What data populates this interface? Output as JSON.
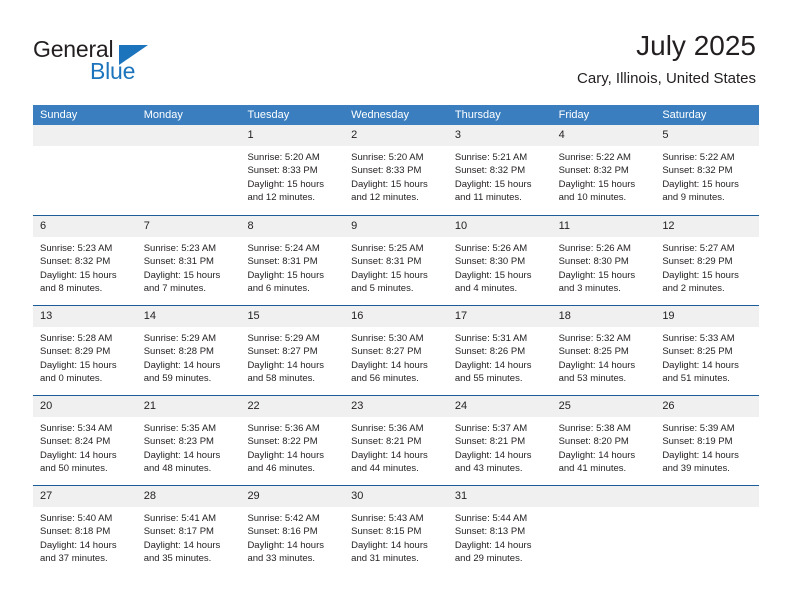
{
  "brand": {
    "name_part1": "General",
    "name_part2": "Blue",
    "accent_color": "#1c75bc"
  },
  "header": {
    "title": "July 2025",
    "subtitle": "Cary, Illinois, United States"
  },
  "theme": {
    "header_bar_color": "#3a7ebf",
    "row_divider_color": "#1c5d99",
    "day_number_bg": "#f0f0f0",
    "text_color": "#231f20"
  },
  "weekdays": [
    "Sunday",
    "Monday",
    "Tuesday",
    "Wednesday",
    "Thursday",
    "Friday",
    "Saturday"
  ],
  "weeks": [
    [
      {
        "day": "",
        "lines": []
      },
      {
        "day": "",
        "lines": []
      },
      {
        "day": "1",
        "lines": [
          "Sunrise: 5:20 AM",
          "Sunset: 8:33 PM",
          "Daylight: 15 hours",
          "and 12 minutes."
        ]
      },
      {
        "day": "2",
        "lines": [
          "Sunrise: 5:20 AM",
          "Sunset: 8:33 PM",
          "Daylight: 15 hours",
          "and 12 minutes."
        ]
      },
      {
        "day": "3",
        "lines": [
          "Sunrise: 5:21 AM",
          "Sunset: 8:32 PM",
          "Daylight: 15 hours",
          "and 11 minutes."
        ]
      },
      {
        "day": "4",
        "lines": [
          "Sunrise: 5:22 AM",
          "Sunset: 8:32 PM",
          "Daylight: 15 hours",
          "and 10 minutes."
        ]
      },
      {
        "day": "5",
        "lines": [
          "Sunrise: 5:22 AM",
          "Sunset: 8:32 PM",
          "Daylight: 15 hours",
          "and 9 minutes."
        ]
      }
    ],
    [
      {
        "day": "6",
        "lines": [
          "Sunrise: 5:23 AM",
          "Sunset: 8:32 PM",
          "Daylight: 15 hours",
          "and 8 minutes."
        ]
      },
      {
        "day": "7",
        "lines": [
          "Sunrise: 5:23 AM",
          "Sunset: 8:31 PM",
          "Daylight: 15 hours",
          "and 7 minutes."
        ]
      },
      {
        "day": "8",
        "lines": [
          "Sunrise: 5:24 AM",
          "Sunset: 8:31 PM",
          "Daylight: 15 hours",
          "and 6 minutes."
        ]
      },
      {
        "day": "9",
        "lines": [
          "Sunrise: 5:25 AM",
          "Sunset: 8:31 PM",
          "Daylight: 15 hours",
          "and 5 minutes."
        ]
      },
      {
        "day": "10",
        "lines": [
          "Sunrise: 5:26 AM",
          "Sunset: 8:30 PM",
          "Daylight: 15 hours",
          "and 4 minutes."
        ]
      },
      {
        "day": "11",
        "lines": [
          "Sunrise: 5:26 AM",
          "Sunset: 8:30 PM",
          "Daylight: 15 hours",
          "and 3 minutes."
        ]
      },
      {
        "day": "12",
        "lines": [
          "Sunrise: 5:27 AM",
          "Sunset: 8:29 PM",
          "Daylight: 15 hours",
          "and 2 minutes."
        ]
      }
    ],
    [
      {
        "day": "13",
        "lines": [
          "Sunrise: 5:28 AM",
          "Sunset: 8:29 PM",
          "Daylight: 15 hours",
          "and 0 minutes."
        ]
      },
      {
        "day": "14",
        "lines": [
          "Sunrise: 5:29 AM",
          "Sunset: 8:28 PM",
          "Daylight: 14 hours",
          "and 59 minutes."
        ]
      },
      {
        "day": "15",
        "lines": [
          "Sunrise: 5:29 AM",
          "Sunset: 8:27 PM",
          "Daylight: 14 hours",
          "and 58 minutes."
        ]
      },
      {
        "day": "16",
        "lines": [
          "Sunrise: 5:30 AM",
          "Sunset: 8:27 PM",
          "Daylight: 14 hours",
          "and 56 minutes."
        ]
      },
      {
        "day": "17",
        "lines": [
          "Sunrise: 5:31 AM",
          "Sunset: 8:26 PM",
          "Daylight: 14 hours",
          "and 55 minutes."
        ]
      },
      {
        "day": "18",
        "lines": [
          "Sunrise: 5:32 AM",
          "Sunset: 8:25 PM",
          "Daylight: 14 hours",
          "and 53 minutes."
        ]
      },
      {
        "day": "19",
        "lines": [
          "Sunrise: 5:33 AM",
          "Sunset: 8:25 PM",
          "Daylight: 14 hours",
          "and 51 minutes."
        ]
      }
    ],
    [
      {
        "day": "20",
        "lines": [
          "Sunrise: 5:34 AM",
          "Sunset: 8:24 PM",
          "Daylight: 14 hours",
          "and 50 minutes."
        ]
      },
      {
        "day": "21",
        "lines": [
          "Sunrise: 5:35 AM",
          "Sunset: 8:23 PM",
          "Daylight: 14 hours",
          "and 48 minutes."
        ]
      },
      {
        "day": "22",
        "lines": [
          "Sunrise: 5:36 AM",
          "Sunset: 8:22 PM",
          "Daylight: 14 hours",
          "and 46 minutes."
        ]
      },
      {
        "day": "23",
        "lines": [
          "Sunrise: 5:36 AM",
          "Sunset: 8:21 PM",
          "Daylight: 14 hours",
          "and 44 minutes."
        ]
      },
      {
        "day": "24",
        "lines": [
          "Sunrise: 5:37 AM",
          "Sunset: 8:21 PM",
          "Daylight: 14 hours",
          "and 43 minutes."
        ]
      },
      {
        "day": "25",
        "lines": [
          "Sunrise: 5:38 AM",
          "Sunset: 8:20 PM",
          "Daylight: 14 hours",
          "and 41 minutes."
        ]
      },
      {
        "day": "26",
        "lines": [
          "Sunrise: 5:39 AM",
          "Sunset: 8:19 PM",
          "Daylight: 14 hours",
          "and 39 minutes."
        ]
      }
    ],
    [
      {
        "day": "27",
        "lines": [
          "Sunrise: 5:40 AM",
          "Sunset: 8:18 PM",
          "Daylight: 14 hours",
          "and 37 minutes."
        ]
      },
      {
        "day": "28",
        "lines": [
          "Sunrise: 5:41 AM",
          "Sunset: 8:17 PM",
          "Daylight: 14 hours",
          "and 35 minutes."
        ]
      },
      {
        "day": "29",
        "lines": [
          "Sunrise: 5:42 AM",
          "Sunset: 8:16 PM",
          "Daylight: 14 hours",
          "and 33 minutes."
        ]
      },
      {
        "day": "30",
        "lines": [
          "Sunrise: 5:43 AM",
          "Sunset: 8:15 PM",
          "Daylight: 14 hours",
          "and 31 minutes."
        ]
      },
      {
        "day": "31",
        "lines": [
          "Sunrise: 5:44 AM",
          "Sunset: 8:13 PM",
          "Daylight: 14 hours",
          "and 29 minutes."
        ]
      },
      {
        "day": "",
        "lines": []
      },
      {
        "day": "",
        "lines": []
      }
    ]
  ]
}
